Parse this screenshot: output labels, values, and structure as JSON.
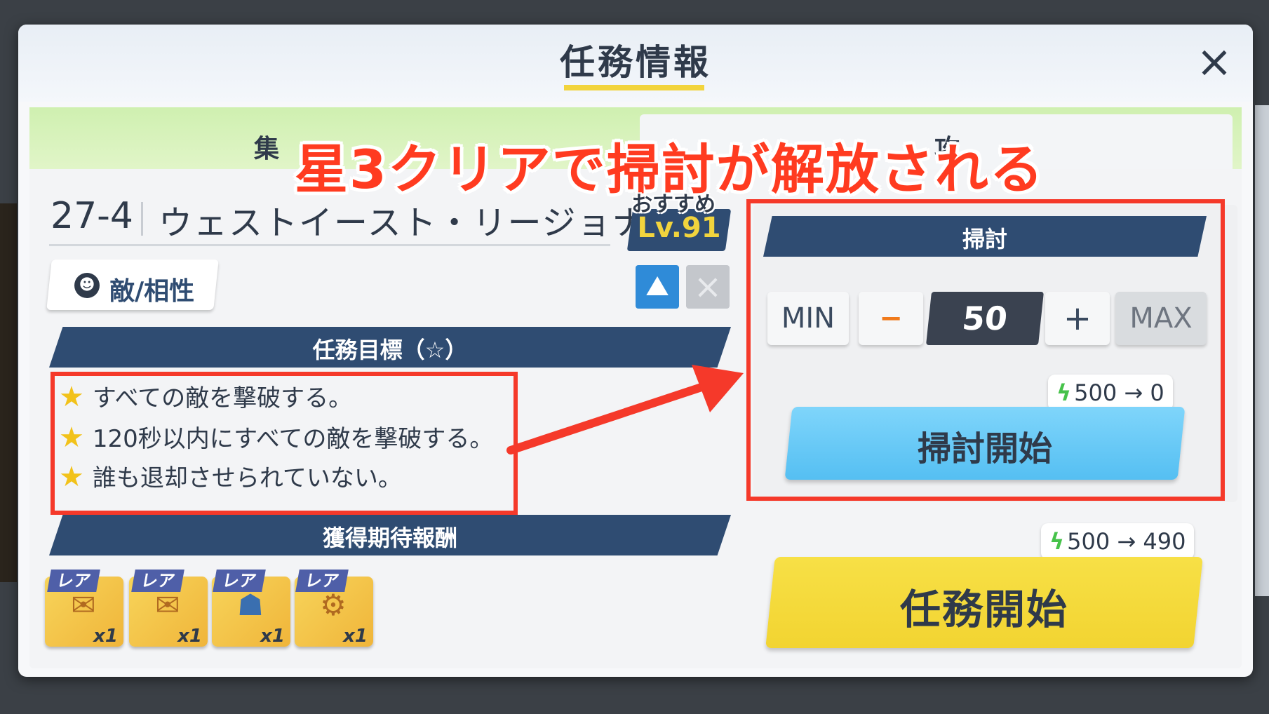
{
  "modal": {
    "title": "任務情報",
    "close": "×"
  },
  "tabs": {
    "left": "集",
    "right": "攻"
  },
  "annotation": "星3クリアで掃討が解放される",
  "stage": {
    "code": "27-4",
    "name": "ウェストイースト・リージョナル",
    "recommended_label": "おすすめ",
    "recommended_level": "Lv.91"
  },
  "enemy_button": {
    "label": "敵/相性"
  },
  "objectives": {
    "header": "任務目標（☆）",
    "items": [
      "すべての敵を撃破する。",
      "120秒以内にすべての敵を撃破する。",
      "誰も退却させられていない。"
    ]
  },
  "rewards": {
    "header": "獲得期待報酬",
    "items": [
      {
        "rarity": "レア",
        "count": "x1",
        "icon": "scroll-icon"
      },
      {
        "rarity": "レア",
        "count": "x1",
        "icon": "scroll-icon"
      },
      {
        "rarity": "レア",
        "count": "x1",
        "icon": "mask-icon"
      },
      {
        "rarity": "レア",
        "count": "x1",
        "icon": "gear-part-icon"
      }
    ]
  },
  "sweep": {
    "header": "掃討",
    "min_label": "MIN",
    "minus_label": "−",
    "count": "50",
    "plus_label": "+",
    "max_label": "MAX",
    "ap_cost": "500 → 0",
    "start_label": "掃討開始"
  },
  "mission": {
    "ap_cost": "500 → 490",
    "start_label": "任務開始"
  },
  "colors": {
    "accent_red": "#f5392a",
    "navy": "#2f4c72",
    "sweep_blue": "#55bff2",
    "start_yellow": "#f2d431",
    "star_yellow": "#f2c21a"
  }
}
